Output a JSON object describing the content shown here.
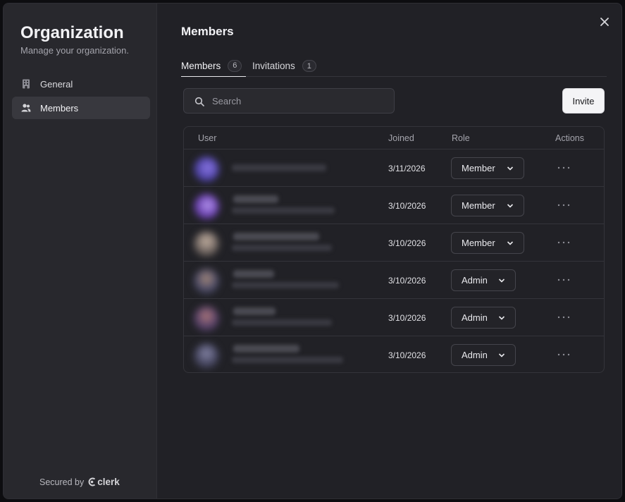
{
  "sidebar": {
    "title": "Organization",
    "subtitle": "Manage your organization.",
    "items": [
      {
        "label": "General",
        "icon": "building-icon"
      },
      {
        "label": "Members",
        "icon": "users-icon"
      }
    ],
    "footer": {
      "secured_label": "Secured by",
      "brand": "clerk"
    }
  },
  "main": {
    "title": "Members",
    "tabs": [
      {
        "label": "Members",
        "count": "6"
      },
      {
        "label": "Invitations",
        "count": "1"
      }
    ],
    "search": {
      "placeholder": "Search",
      "value": ""
    },
    "invite_label": "Invite",
    "table": {
      "headers": {
        "user": "User",
        "joined": "Joined",
        "role": "Role",
        "actions": "Actions"
      },
      "rows": [
        {
          "joined": "3/11/2026",
          "role": "Member"
        },
        {
          "joined": "3/10/2026",
          "role": "Member"
        },
        {
          "joined": "3/10/2026",
          "role": "Member"
        },
        {
          "joined": "3/10/2026",
          "role": "Admin"
        },
        {
          "joined": "3/10/2026",
          "role": "Admin"
        },
        {
          "joined": "3/10/2026",
          "role": "Admin"
        }
      ],
      "actions_glyph": "···"
    }
  },
  "colors": {
    "modal_bg": "#212126",
    "sidebar_bg": "#28282d",
    "active_nav_bg": "#38383e",
    "invite_bg": "#f4f4f6"
  }
}
